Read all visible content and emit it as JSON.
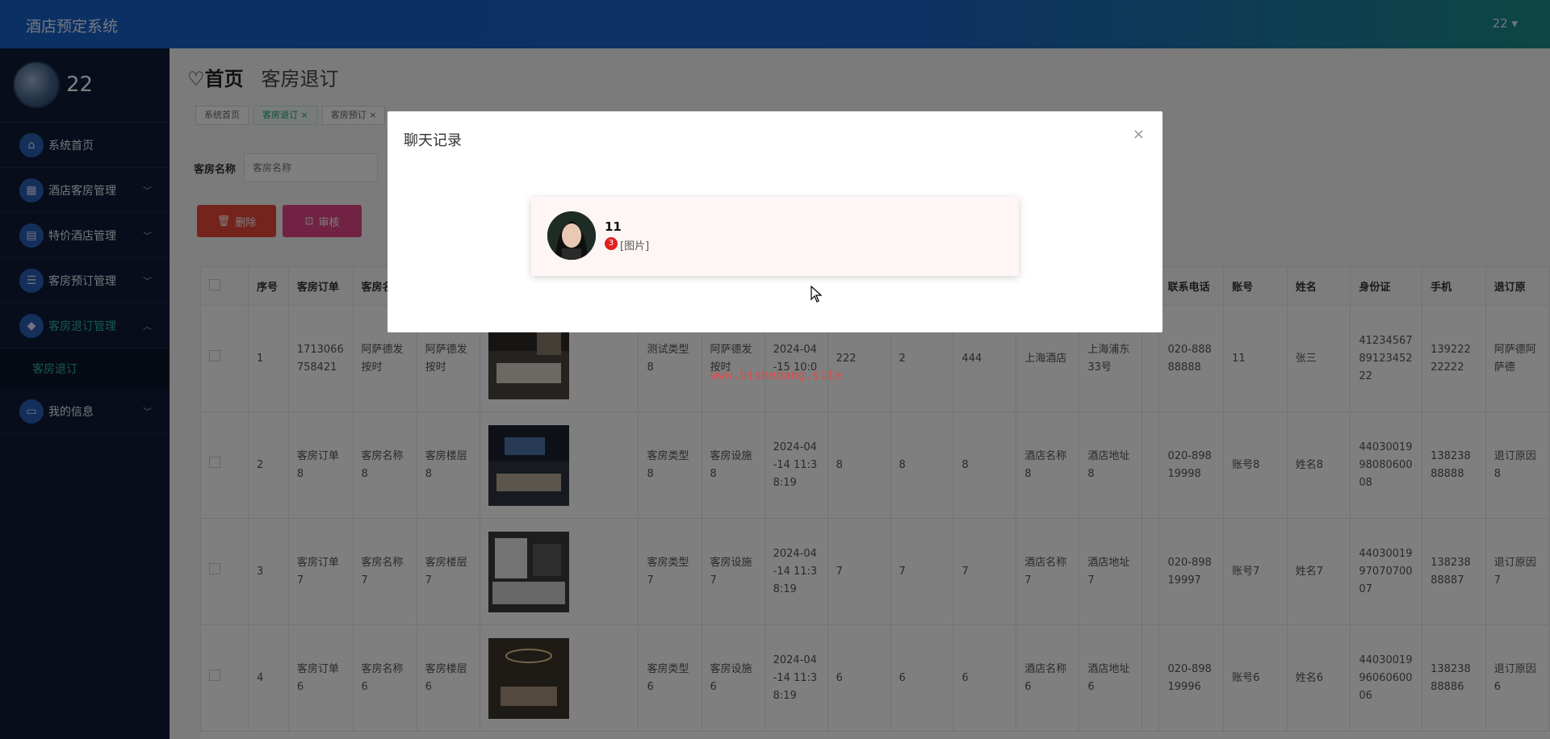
{
  "app": {
    "title": "酒店预定系统",
    "user_menu": "22 ▾"
  },
  "sidebar": {
    "profile_name": "22",
    "items": [
      {
        "label": "系统首页",
        "icon": "home-icon",
        "glyph": "⌂",
        "has_children": false
      },
      {
        "label": "酒店客房管理",
        "icon": "building-icon",
        "glyph": "▦",
        "has_children": true,
        "chevron": "﹀"
      },
      {
        "label": "特价酒店管理",
        "icon": "clipboard-icon",
        "glyph": "▤",
        "has_children": true,
        "chevron": "﹀"
      },
      {
        "label": "客房预订管理",
        "icon": "sliders-icon",
        "glyph": "☰",
        "has_children": true,
        "chevron": "﹀"
      },
      {
        "label": "客房退订管理",
        "icon": "shield-icon",
        "glyph": "◆",
        "has_children": true,
        "chevron": "︿",
        "open": true
      },
      {
        "label": "我的信息",
        "icon": "card-icon",
        "glyph": "▭",
        "has_children": true,
        "chevron": "﹀"
      }
    ],
    "sub_item": "客房退订"
  },
  "breadcrumb": {
    "home_icon": "♡",
    "home": "首页",
    "current": "客房退订"
  },
  "tags": [
    "系统首页",
    "客房退订 ×",
    "客房预订 ×"
  ],
  "search": {
    "label": "客房名称",
    "placeholder": "客房名称"
  },
  "buttons": {
    "delete": "删除",
    "delete_glyph": "🗑",
    "review": "审核",
    "review_glyph": "⊡"
  },
  "table": {
    "headers": [
      "",
      "序号",
      "客房订单",
      "客房名",
      "",
      "",
      "",
      "",
      "",
      "",
      "",
      "",
      "",
      "",
      "",
      "联系电话",
      "账号",
      "姓名",
      "身份证",
      "手机",
      "退订原"
    ],
    "rows": [
      [
        "",
        "1",
        "1713066758421",
        "阿萨德发按时",
        "阿萨德发按时",
        "",
        "测试类型8",
        "阿萨德发按时",
        "2024-04-15 10:0",
        "222",
        "2",
        "444",
        "上海酒店",
        "上海浦东33号",
        "",
        "020-88888888",
        "11",
        "张三",
        "412345678912345222",
        "13922222222",
        "阿萨德阿萨德"
      ],
      [
        "",
        "2",
        "客房订单8",
        "客房名称8",
        "客房楼层8",
        "",
        "客房类型8",
        "客房设施8",
        "2024-04-14 11:38:19",
        "8",
        "8",
        "8",
        "酒店名称8",
        "酒店地址8",
        "",
        "020-89819998",
        "账号8",
        "姓名8",
        "440300199808060008",
        "13823888888",
        "退订原因8"
      ],
      [
        "",
        "3",
        "客房订单7",
        "客房名称7",
        "客房楼层7",
        "",
        "客房类型7",
        "客房设施7",
        "2024-04-14 11:38:19",
        "7",
        "7",
        "7",
        "酒店名称7",
        "酒店地址7",
        "",
        "020-89819997",
        "账号7",
        "姓名7",
        "440300199707070007",
        "13823888887",
        "退订原因7"
      ],
      [
        "",
        "4",
        "客房订单6",
        "客房名称6",
        "客房楼层6",
        "",
        "客房类型6",
        "客房设施6",
        "2024-04-14 11:38:19",
        "6",
        "6",
        "6",
        "酒店名称6",
        "酒店地址6",
        "",
        "020-89819996",
        "账号6",
        "姓名6",
        "440300199606060006",
        "13823888886",
        "退订原因6"
      ]
    ]
  },
  "modal": {
    "title": "聊天记录",
    "close_glyph": "×",
    "chat": {
      "name": "11",
      "unread": "3",
      "message": "[图片]"
    }
  },
  "watermark": "www.bishebang.site"
}
